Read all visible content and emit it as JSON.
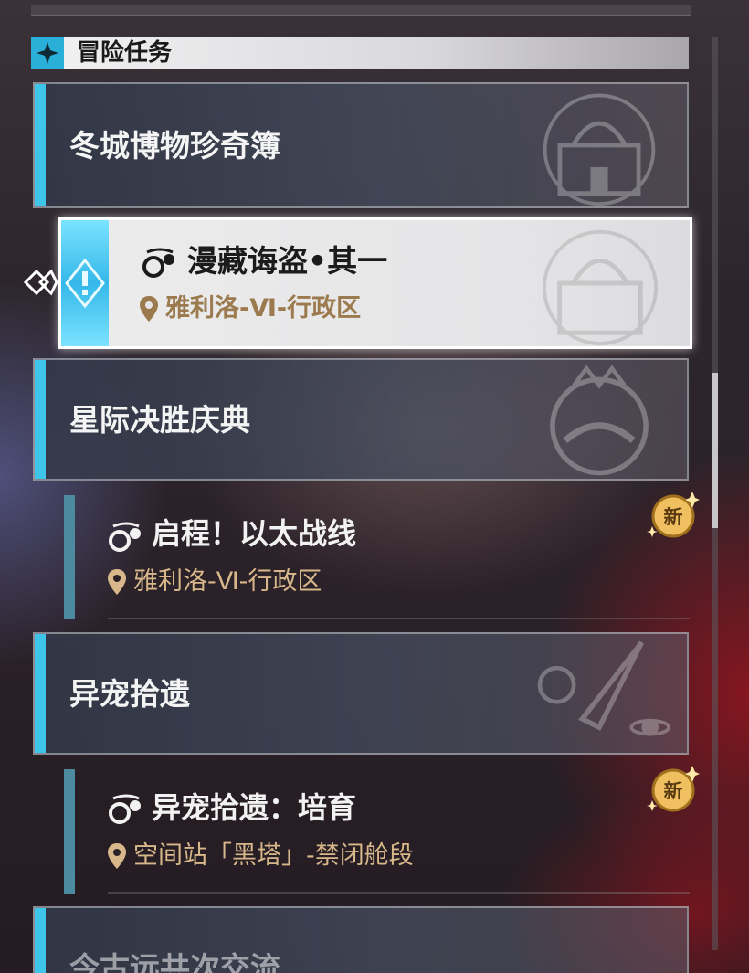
{
  "header": {
    "title": "冒险任务",
    "icon": "diamond-star-icon"
  },
  "categories": [
    {
      "label": "冬城博物珍奇簿"
    },
    {
      "label": "星际决胜庆典"
    },
    {
      "label": "异宠拾遗"
    },
    {
      "label": "今古远共次交流"
    }
  ],
  "quests": [
    {
      "title": "漫藏诲盗•其一",
      "location": "雅利洛-Ⅵ-行政区",
      "selected": true
    },
    {
      "title": "启程！以太战线",
      "location": "雅利洛-Ⅵ-行政区",
      "badge": "新"
    },
    {
      "title": "异宠拾遗：培育",
      "location": "空间站「黑塔」-禁闭舱段",
      "badge": "新"
    }
  ],
  "colors": {
    "accent": "#3ec5ea",
    "location_text": "#d8b88a",
    "badge_gold": "#f0c060"
  }
}
